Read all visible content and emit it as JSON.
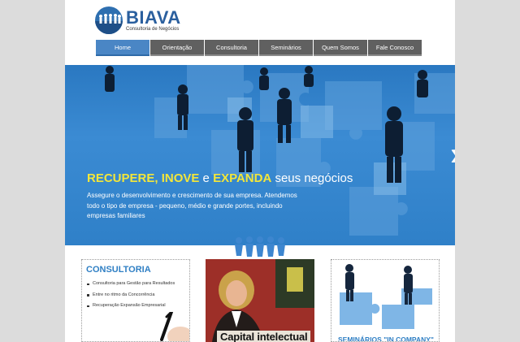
{
  "brand": {
    "name": "BIAVA",
    "tagline": "Consultoria de Negócios",
    "color": "#2a5f9e"
  },
  "nav": {
    "items": [
      "Home",
      "Orientação",
      "Consultoria",
      "Seminários",
      "Quem Somos",
      "Fale Conosco"
    ],
    "active": "Home"
  },
  "hero": {
    "headline_parts": {
      "recupere": "RECUPERE, ",
      "inove": "INOVE",
      "e": " e ",
      "expanda": "EXPANDA",
      "rest": " seus negócios"
    },
    "text": "Assegure o desenvolvimento e crescimento de sua empresa. Atendemos todo o tipo de empresa - pequeno, médio e grande portes, incluindo empresas familiares",
    "prev_icon": "double-chevron-left-icon",
    "next_icon": "double-chevron-right-icon",
    "accent": "#f3e63a"
  },
  "cards": {
    "consultoria": {
      "title": "CONSULTORIA",
      "items": [
        "Consultoria para Gestão para Resultados",
        "Entre no ritmo da Concorrência",
        "Recuperação Expansão Empresarial"
      ]
    },
    "capital": {
      "title": "Capital intelectual"
    },
    "seminarios": {
      "title": "SEMINÁRIOS \"IN COMPANY\""
    }
  }
}
